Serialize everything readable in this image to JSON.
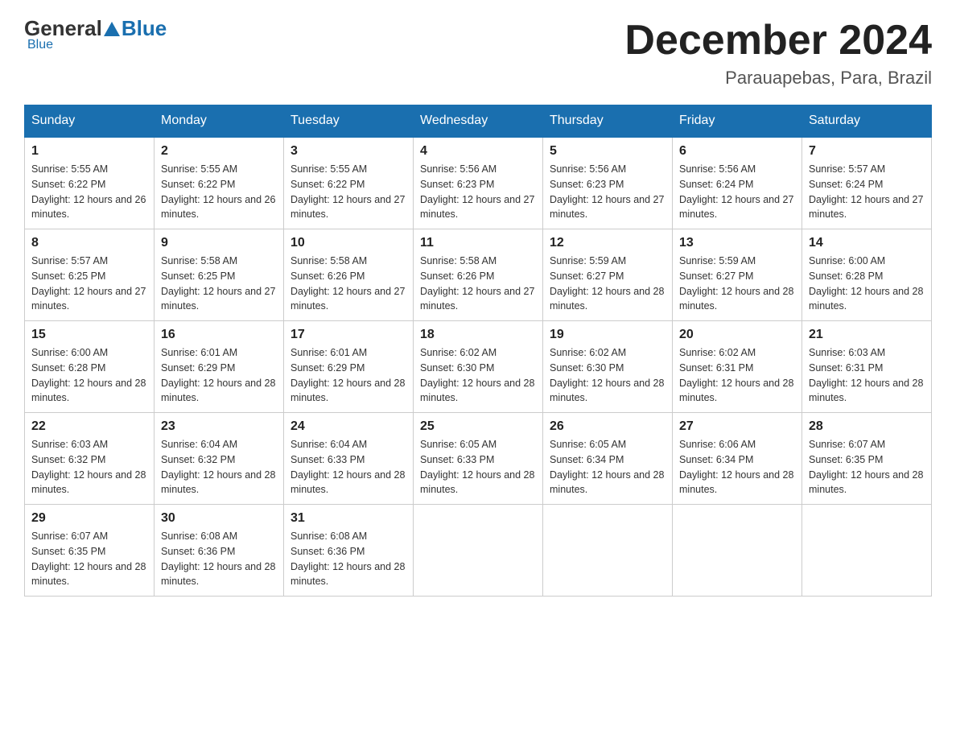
{
  "logo": {
    "general": "General",
    "blue": "Blue"
  },
  "title": "December 2024",
  "location": "Parauapebas, Para, Brazil",
  "headers": [
    "Sunday",
    "Monday",
    "Tuesday",
    "Wednesday",
    "Thursday",
    "Friday",
    "Saturday"
  ],
  "weeks": [
    [
      {
        "day": "1",
        "sunrise": "5:55 AM",
        "sunset": "6:22 PM",
        "daylight": "12 hours and 26 minutes"
      },
      {
        "day": "2",
        "sunrise": "5:55 AM",
        "sunset": "6:22 PM",
        "daylight": "12 hours and 26 minutes"
      },
      {
        "day": "3",
        "sunrise": "5:55 AM",
        "sunset": "6:22 PM",
        "daylight": "12 hours and 27 minutes"
      },
      {
        "day": "4",
        "sunrise": "5:56 AM",
        "sunset": "6:23 PM",
        "daylight": "12 hours and 27 minutes"
      },
      {
        "day": "5",
        "sunrise": "5:56 AM",
        "sunset": "6:23 PM",
        "daylight": "12 hours and 27 minutes"
      },
      {
        "day": "6",
        "sunrise": "5:56 AM",
        "sunset": "6:24 PM",
        "daylight": "12 hours and 27 minutes"
      },
      {
        "day": "7",
        "sunrise": "5:57 AM",
        "sunset": "6:24 PM",
        "daylight": "12 hours and 27 minutes"
      }
    ],
    [
      {
        "day": "8",
        "sunrise": "5:57 AM",
        "sunset": "6:25 PM",
        "daylight": "12 hours and 27 minutes"
      },
      {
        "day": "9",
        "sunrise": "5:58 AM",
        "sunset": "6:25 PM",
        "daylight": "12 hours and 27 minutes"
      },
      {
        "day": "10",
        "sunrise": "5:58 AM",
        "sunset": "6:26 PM",
        "daylight": "12 hours and 27 minutes"
      },
      {
        "day": "11",
        "sunrise": "5:58 AM",
        "sunset": "6:26 PM",
        "daylight": "12 hours and 27 minutes"
      },
      {
        "day": "12",
        "sunrise": "5:59 AM",
        "sunset": "6:27 PM",
        "daylight": "12 hours and 28 minutes"
      },
      {
        "day": "13",
        "sunrise": "5:59 AM",
        "sunset": "6:27 PM",
        "daylight": "12 hours and 28 minutes"
      },
      {
        "day": "14",
        "sunrise": "6:00 AM",
        "sunset": "6:28 PM",
        "daylight": "12 hours and 28 minutes"
      }
    ],
    [
      {
        "day": "15",
        "sunrise": "6:00 AM",
        "sunset": "6:28 PM",
        "daylight": "12 hours and 28 minutes"
      },
      {
        "day": "16",
        "sunrise": "6:01 AM",
        "sunset": "6:29 PM",
        "daylight": "12 hours and 28 minutes"
      },
      {
        "day": "17",
        "sunrise": "6:01 AM",
        "sunset": "6:29 PM",
        "daylight": "12 hours and 28 minutes"
      },
      {
        "day": "18",
        "sunrise": "6:02 AM",
        "sunset": "6:30 PM",
        "daylight": "12 hours and 28 minutes"
      },
      {
        "day": "19",
        "sunrise": "6:02 AM",
        "sunset": "6:30 PM",
        "daylight": "12 hours and 28 minutes"
      },
      {
        "day": "20",
        "sunrise": "6:02 AM",
        "sunset": "6:31 PM",
        "daylight": "12 hours and 28 minutes"
      },
      {
        "day": "21",
        "sunrise": "6:03 AM",
        "sunset": "6:31 PM",
        "daylight": "12 hours and 28 minutes"
      }
    ],
    [
      {
        "day": "22",
        "sunrise": "6:03 AM",
        "sunset": "6:32 PM",
        "daylight": "12 hours and 28 minutes"
      },
      {
        "day": "23",
        "sunrise": "6:04 AM",
        "sunset": "6:32 PM",
        "daylight": "12 hours and 28 minutes"
      },
      {
        "day": "24",
        "sunrise": "6:04 AM",
        "sunset": "6:33 PM",
        "daylight": "12 hours and 28 minutes"
      },
      {
        "day": "25",
        "sunrise": "6:05 AM",
        "sunset": "6:33 PM",
        "daylight": "12 hours and 28 minutes"
      },
      {
        "day": "26",
        "sunrise": "6:05 AM",
        "sunset": "6:34 PM",
        "daylight": "12 hours and 28 minutes"
      },
      {
        "day": "27",
        "sunrise": "6:06 AM",
        "sunset": "6:34 PM",
        "daylight": "12 hours and 28 minutes"
      },
      {
        "day": "28",
        "sunrise": "6:07 AM",
        "sunset": "6:35 PM",
        "daylight": "12 hours and 28 minutes"
      }
    ],
    [
      {
        "day": "29",
        "sunrise": "6:07 AM",
        "sunset": "6:35 PM",
        "daylight": "12 hours and 28 minutes"
      },
      {
        "day": "30",
        "sunrise": "6:08 AM",
        "sunset": "6:36 PM",
        "daylight": "12 hours and 28 minutes"
      },
      {
        "day": "31",
        "sunrise": "6:08 AM",
        "sunset": "6:36 PM",
        "daylight": "12 hours and 28 minutes"
      },
      null,
      null,
      null,
      null
    ]
  ]
}
